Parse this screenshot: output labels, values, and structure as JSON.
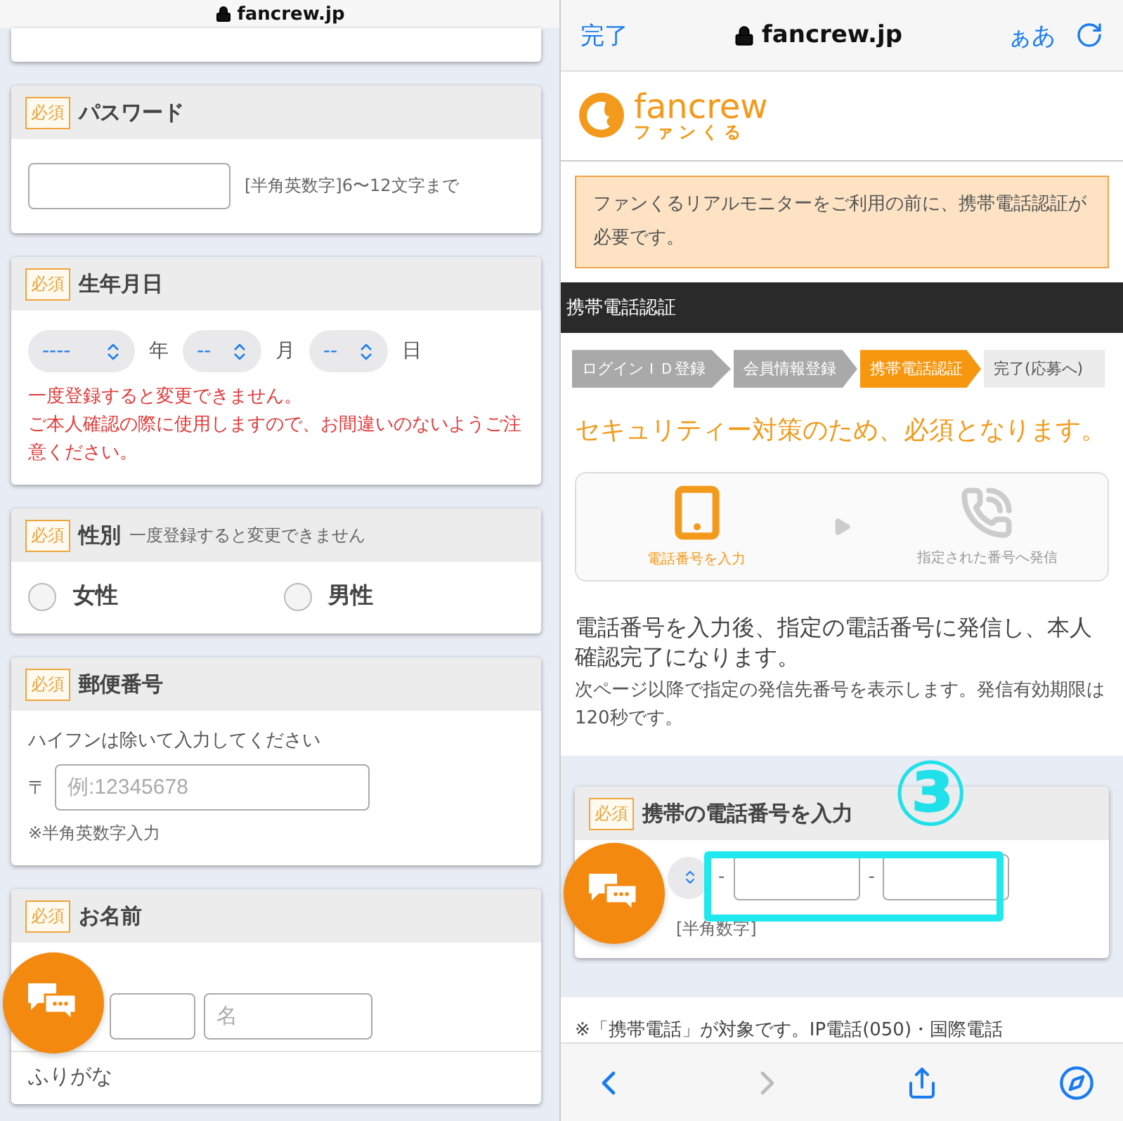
{
  "left_pane": {
    "address_bar": {
      "domain": "fancrew.jp"
    },
    "password": {
      "badge": "必須",
      "title": "パスワード",
      "hint": "[半角英数字]6〜12文字まで"
    },
    "birthday": {
      "badge": "必須",
      "title": "生年月日",
      "selects": [
        {
          "value": "----",
          "unit": "年"
        },
        {
          "value": "--",
          "unit": "月"
        },
        {
          "value": "--",
          "unit": "日"
        }
      ],
      "warnings": [
        "一度登録すると変更できません。",
        "ご本人確認の際に使用しますので、お間違いのないようご注意ください。"
      ]
    },
    "gender": {
      "badge": "必須",
      "title": "性別",
      "note": "一度登録すると変更できません",
      "options": [
        {
          "label": "女性",
          "selected": false
        },
        {
          "label": "男性",
          "selected": false
        }
      ]
    },
    "postal": {
      "badge": "必須",
      "title": "郵便番号",
      "instruction": "ハイフンは除いて入力してください",
      "prefix": "〒",
      "placeholder": "例:12345678",
      "note": "※半角英数字入力"
    },
    "name": {
      "badge": "必須",
      "title": "お名前",
      "first_name_placeholder": "名",
      "furigana_label": "ふりがな"
    }
  },
  "right_pane": {
    "browser_bar": {
      "done": "完了",
      "domain": "fancrew.jp",
      "text_size": "ぁあ"
    },
    "logo": {
      "name": "fancrew",
      "kana": "ファンくる"
    },
    "notice": "ファンくるリアルモニターをご利用の前に、携帯電話認証が必要です。",
    "section_title": "携帯電話認証",
    "steps": [
      {
        "label": "ログインＩＤ登録",
        "completed": true,
        "selected": false
      },
      {
        "label": "会員情報登録",
        "completed": true,
        "selected": false
      },
      {
        "label": "携帯電話認証",
        "completed": false,
        "selected": true
      },
      {
        "label": "完了(応募へ)",
        "completed": false,
        "selected": false
      }
    ],
    "headline": "セキュリティー対策のため、必須となります。",
    "flow": [
      {
        "label": "電話番号を入力",
        "selected": true
      },
      {
        "label": "指定された番号へ発信",
        "selected": false
      }
    ],
    "description": "電話番号を入力後、指定の電話番号に発信し、本人確認完了になります。",
    "sub_description": "次ページ以降で指定の発信先番号を表示します。発信有効期限は120秒です。",
    "phone_card": {
      "badge": "必須",
      "title": "携帯の電話番号を入力",
      "separators": [
        "-",
        "-"
      ],
      "hint": "[半角数字]"
    },
    "footnote": "※「携帯電話」が対象です。IP電話(050)・国際電話",
    "annotation": "③"
  }
}
